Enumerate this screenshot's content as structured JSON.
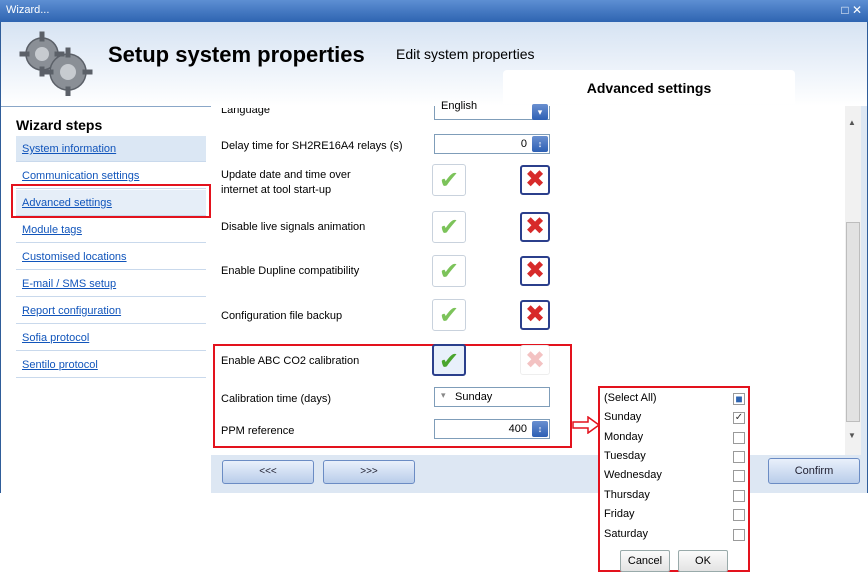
{
  "window": {
    "title": "Wizard...",
    "controls": "□ ✕"
  },
  "header": {
    "title": "Setup system properties",
    "subtitle": "Edit system properties",
    "active_tab": "Advanced settings"
  },
  "sidebar": {
    "heading": "Wizard steps",
    "items": [
      {
        "label": "System information"
      },
      {
        "label": "Communication settings"
      },
      {
        "label": "Advanced settings"
      },
      {
        "label": "Module tags"
      },
      {
        "label": "Customised locations"
      },
      {
        "label": "E-mail / SMS setup"
      },
      {
        "label": "Report configuration"
      },
      {
        "label": "Sofia protocol"
      },
      {
        "label": "Sentilo protocol"
      }
    ]
  },
  "settings": {
    "language_label": "Language",
    "language_value": "English",
    "delay_label": "Delay time for SH2RE16A4 relays (s)",
    "delay_value": "0",
    "update_label_1": "Update date and time over",
    "update_label_2": "internet at tool start-up",
    "animation_label": "Disable live signals animation",
    "dupline_label": "Enable Dupline compatibility",
    "backup_label": "Configuration file backup",
    "abc_label": "Enable ABC CO2 calibration",
    "calib_label": "Calibration time (days)",
    "calib_value": "Sunday",
    "ppm_label": "PPM reference",
    "ppm_value": "400"
  },
  "nav": {
    "prev_label": "<<<",
    "next_label": ">>>",
    "confirm_label": "Confirm"
  },
  "dropdown": {
    "options": [
      {
        "label": "(Select All)",
        "mark": "■"
      },
      {
        "label": "Sunday",
        "mark": "✓"
      },
      {
        "label": "Monday",
        "mark": ""
      },
      {
        "label": "Tuesday",
        "mark": ""
      },
      {
        "label": "Wednesday",
        "mark": ""
      },
      {
        "label": "Thursday",
        "mark": ""
      },
      {
        "label": "Friday",
        "mark": ""
      },
      {
        "label": "Saturday",
        "mark": ""
      }
    ],
    "cancel_label": "Cancel",
    "ok_label": "OK"
  },
  "colors": {
    "accent": "#2e64b1",
    "highlight_border": "#e3121d",
    "check_green": "#7cc35a",
    "cross_red": "#d72a2a"
  }
}
